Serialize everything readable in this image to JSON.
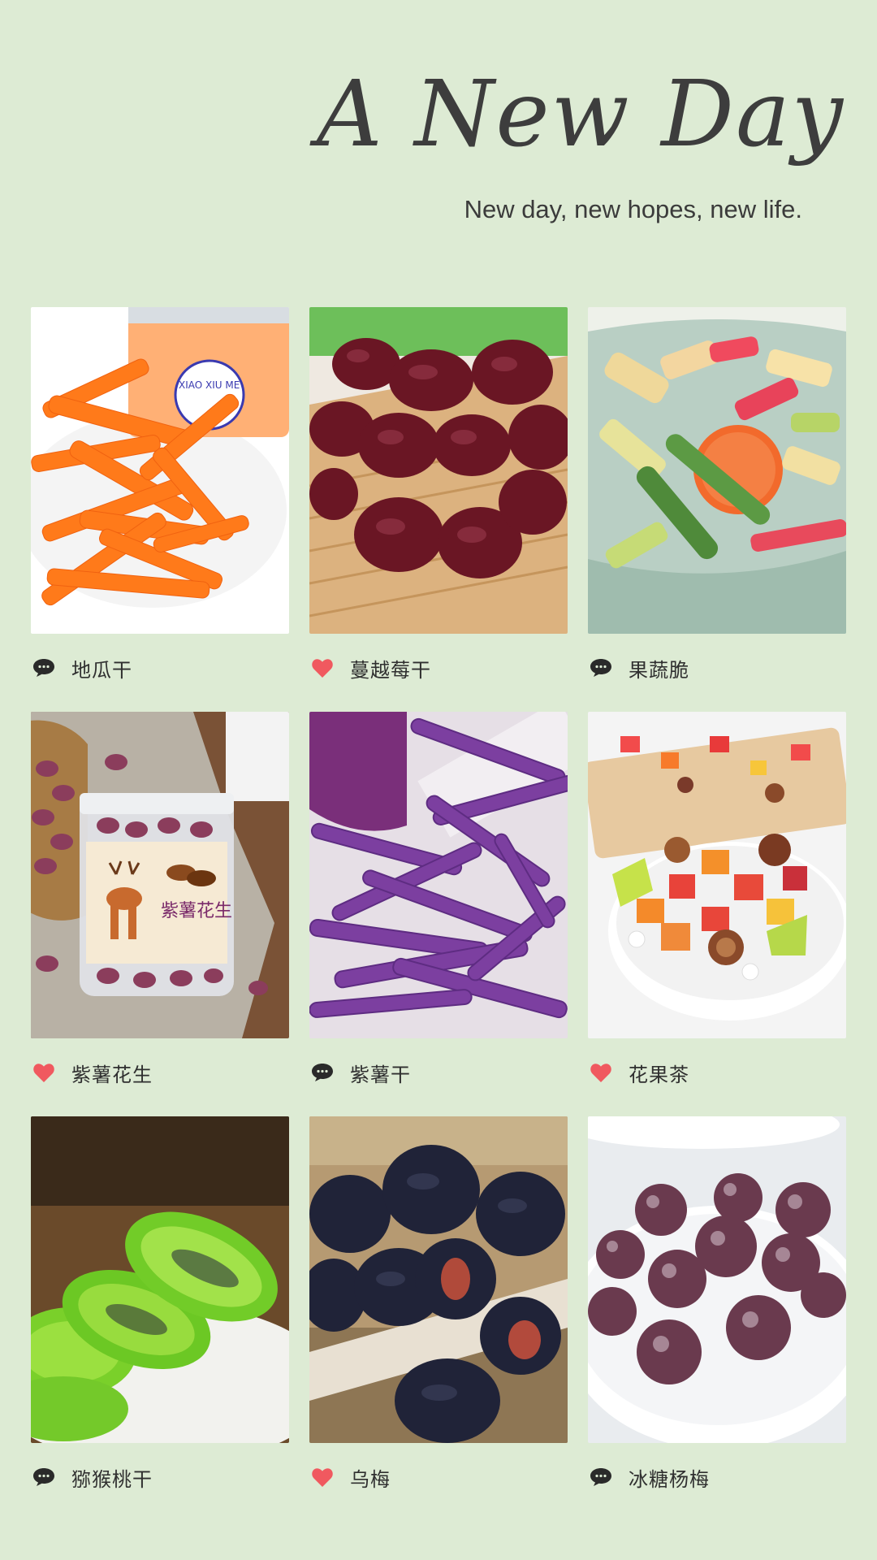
{
  "header": {
    "title": "A New Day",
    "subtitle": "New day, new hopes, new life."
  },
  "items": [
    {
      "label": "地瓜干",
      "icon": "chat-icon",
      "photo": "sweet-potato-strips"
    },
    {
      "label": "蔓越莓干",
      "icon": "heart-icon",
      "photo": "dried-cranberries"
    },
    {
      "label": "果蔬脆",
      "icon": "chat-icon",
      "photo": "fruit-veg-chips"
    },
    {
      "label": "紫薯花生",
      "icon": "heart-icon",
      "photo": "purple-peanuts-jar"
    },
    {
      "label": "紫薯干",
      "icon": "chat-icon",
      "photo": "purple-potato-strips"
    },
    {
      "label": "花果茶",
      "icon": "heart-icon",
      "photo": "flower-fruit-tea"
    },
    {
      "label": "猕猴桃干",
      "icon": "chat-icon",
      "photo": "kiwi-slices"
    },
    {
      "label": "乌梅",
      "icon": "heart-icon",
      "photo": "smoked-plums"
    },
    {
      "label": "冰糖杨梅",
      "icon": "chat-icon",
      "photo": "sugared-bayberries"
    }
  ],
  "colors": {
    "background": "#ddebd4",
    "heart": "#f0595f",
    "chat": "#2a2a2a"
  },
  "jar_text": {
    "brand": "XIAO XIU ME",
    "label": "紫薯花生"
  }
}
